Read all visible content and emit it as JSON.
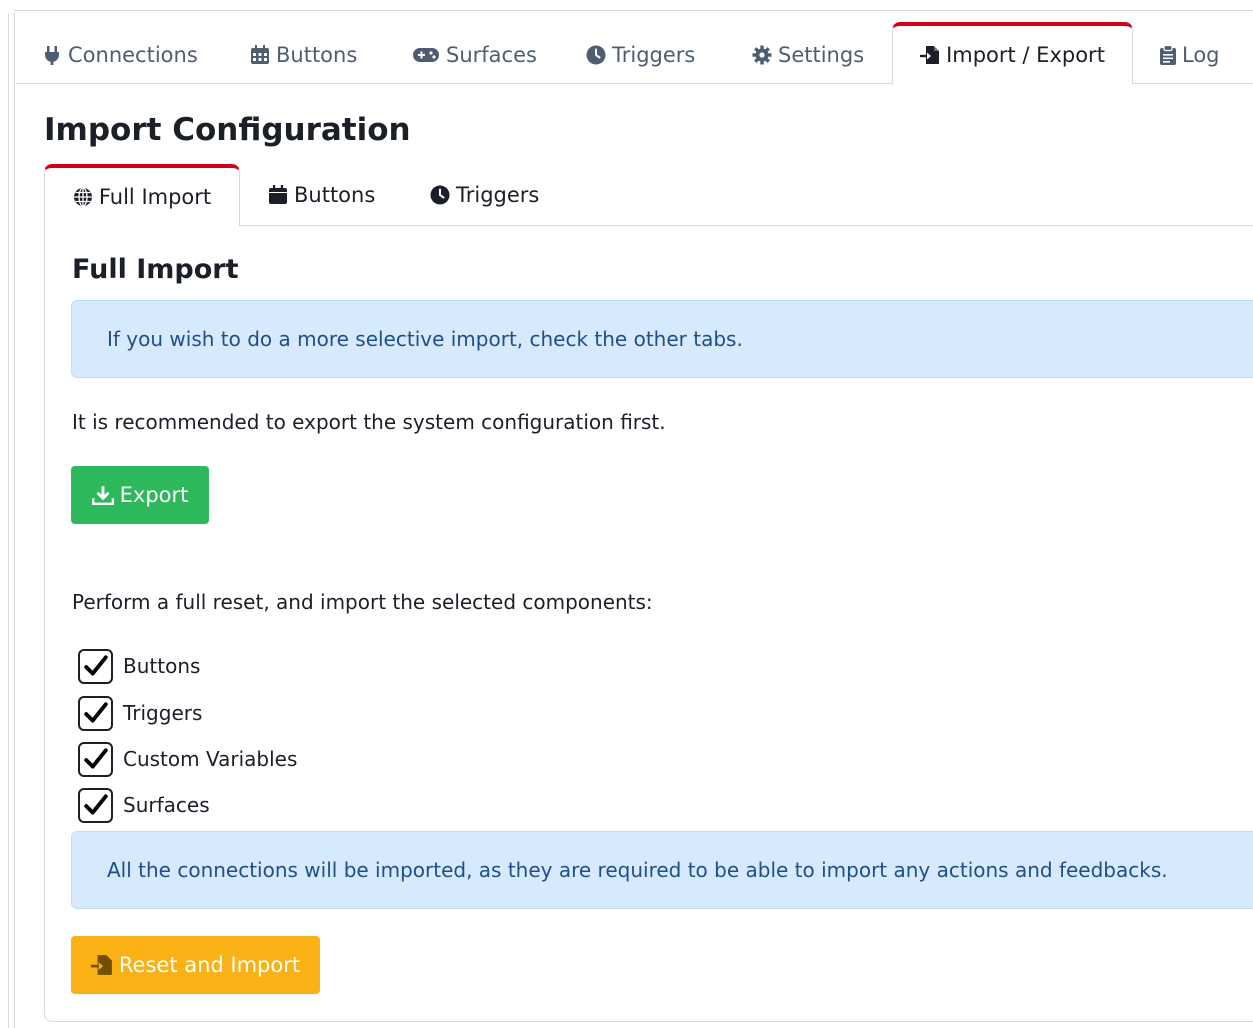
{
  "main_tabs": [
    {
      "label": "Connections",
      "icon": "plug-icon"
    },
    {
      "label": "Buttons",
      "icon": "calendar-grid-icon"
    },
    {
      "label": "Surfaces",
      "icon": "gamepad-icon"
    },
    {
      "label": "Triggers",
      "icon": "clock-icon"
    },
    {
      "label": "Settings",
      "icon": "gear-icon"
    },
    {
      "label": "Import / Export",
      "icon": "file-import-icon",
      "active": true
    },
    {
      "label": "Log",
      "icon": "clipboard-icon"
    }
  ],
  "page_title": "Import Configuration",
  "sub_tabs": [
    {
      "label": "Full Import",
      "icon": "globe-icon",
      "active": true
    },
    {
      "label": "Buttons",
      "icon": "calendar-icon"
    },
    {
      "label": "Triggers",
      "icon": "clock-icon"
    }
  ],
  "section_title": "Full Import",
  "info_alert": "If you wish to do a more selective import, check the other tabs.",
  "recommend_text": "It is recommended to export the system configuration first.",
  "export_button": "Export",
  "reset_text": "Perform a full reset, and import the selected components:",
  "components": [
    {
      "label": "Buttons",
      "checked": true
    },
    {
      "label": "Triggers",
      "checked": true
    },
    {
      "label": "Custom Variables",
      "checked": true
    },
    {
      "label": "Surfaces",
      "checked": true
    }
  ],
  "connections_alert": "All the connections will be imported, as they are required to be able to import any actions and feedbacks.",
  "reset_button": "Reset and Import",
  "colors": {
    "active_tab_accent": "#d0021b",
    "success": "#2eb85c",
    "warning": "#f9b115",
    "info_bg": "#d6e9fd"
  }
}
